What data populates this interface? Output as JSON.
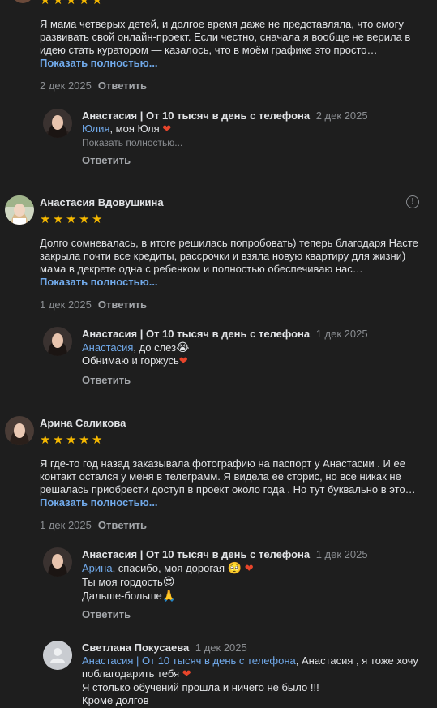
{
  "review0": {
    "text": "Я мама четверых детей, и долгое время даже не представляла, что смогу развивать свой онлайн-проект. Если честно, сначала я вообще не верила в идею стать куратором — казалось, что в моём графике это просто…",
    "show_more": "Показать полностью...",
    "date": "2 дек 2025",
    "reply_label": "Ответить",
    "reply": {
      "author": "Анастасия | От 10 тысяч в день с телефона",
      "date": "2 дек 2025",
      "mention": "Юлия",
      "text": ", моя Юля",
      "show_more": "Показать полностью...",
      "reply_label": "Ответить"
    }
  },
  "review1": {
    "author": "Анастасия Вдовушкина",
    "text": "Долго сомневалась, в итоге решилась попробовать) теперь благодаря Насте закрыла почти все кредиты, рассрочки и взяла новую квартиру для жизни) мама в декрете одна с ребенком и полностью обеспечиваю нас…",
    "show_more": "Показать полностью...",
    "date": "1 дек 2025",
    "reply_label": "Ответить",
    "reply": {
      "author": "Анастасия | От 10 тысяч в день с телефона",
      "date": "1 дек 2025",
      "mention": "Анастасия",
      "line1": ", до слез",
      "line2": "Обнимаю и горжусь",
      "reply_label": "Ответить"
    }
  },
  "review2": {
    "author": "Арина Саликова",
    "text": "Я где-то год назад заказывала фотографию на паспорт у Анастасии . И ее контакт остался у меня в телеграмм. Я видела ее сторис, но все никак не решалась приобрести доступ в проект около года . Но тут буквально в это…",
    "show_more": "Показать полностью...",
    "date": "1 дек 2025",
    "reply_label": "Ответить",
    "reply": {
      "author": "Анастасия | От 10 тысяч в день с телефона",
      "date": "1 дек 2025",
      "mention": "Арина",
      "line1": ", спасибо, моя дорогая",
      "line2": "Ты моя гордость",
      "line3": "Дальше-больше",
      "reply_label": "Ответить"
    },
    "reply2": {
      "author": "Светлана Покусаева",
      "date": "1 дек 2025",
      "mention": "Анастасия | От 10 тысяч в день с телефона",
      "text1": ", Анастасия , я тоже хочу поблагодарить тебя",
      "line2": "Я столько обучений прошла и ничего не было !!!",
      "line3": "Кроме долгов"
    }
  },
  "icons": {
    "star": "★",
    "heart": "❤",
    "info": "!",
    "cry": "😭",
    "heart_eyes": "😍",
    "sad": "🥺",
    "pray": "🙏",
    "user": "user-icon"
  },
  "colors": {
    "background": "#1e1e1e",
    "link": "#71aaeb",
    "star": "#f5b800",
    "heart": "#e8452b"
  }
}
